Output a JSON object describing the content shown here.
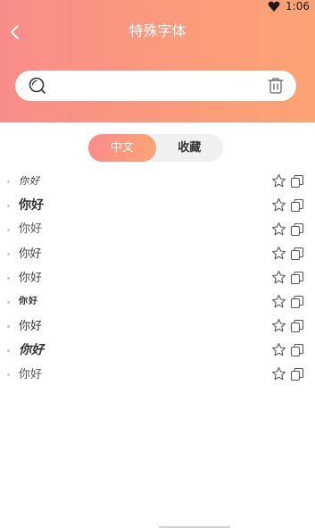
{
  "status_bar": {
    "time": "1:06"
  },
  "header": {
    "title": "特殊字体"
  },
  "search": {
    "placeholder": "",
    "value": ""
  },
  "tabs": [
    {
      "label": "中文",
      "active": true
    },
    {
      "label": "收藏",
      "active": false
    }
  ],
  "list": [
    {
      "text": "你好"
    },
    {
      "text": "你好"
    },
    {
      "text": "你好"
    },
    {
      "text": "你好"
    },
    {
      "text": "你好"
    },
    {
      "text": "你好"
    },
    {
      "text": "你好"
    },
    {
      "text": "你好"
    },
    {
      "text": "你好"
    }
  ],
  "colors": {
    "gradient_start": "#f98d8a",
    "gradient_end": "#fca374",
    "icon_stroke": "#555555"
  },
  "icons": {
    "back": "chevron-left-icon",
    "search": "search-icon",
    "trash": "trash-icon",
    "favorite": "star-icon",
    "copy": "copy-icon",
    "status": "heart-icon"
  }
}
